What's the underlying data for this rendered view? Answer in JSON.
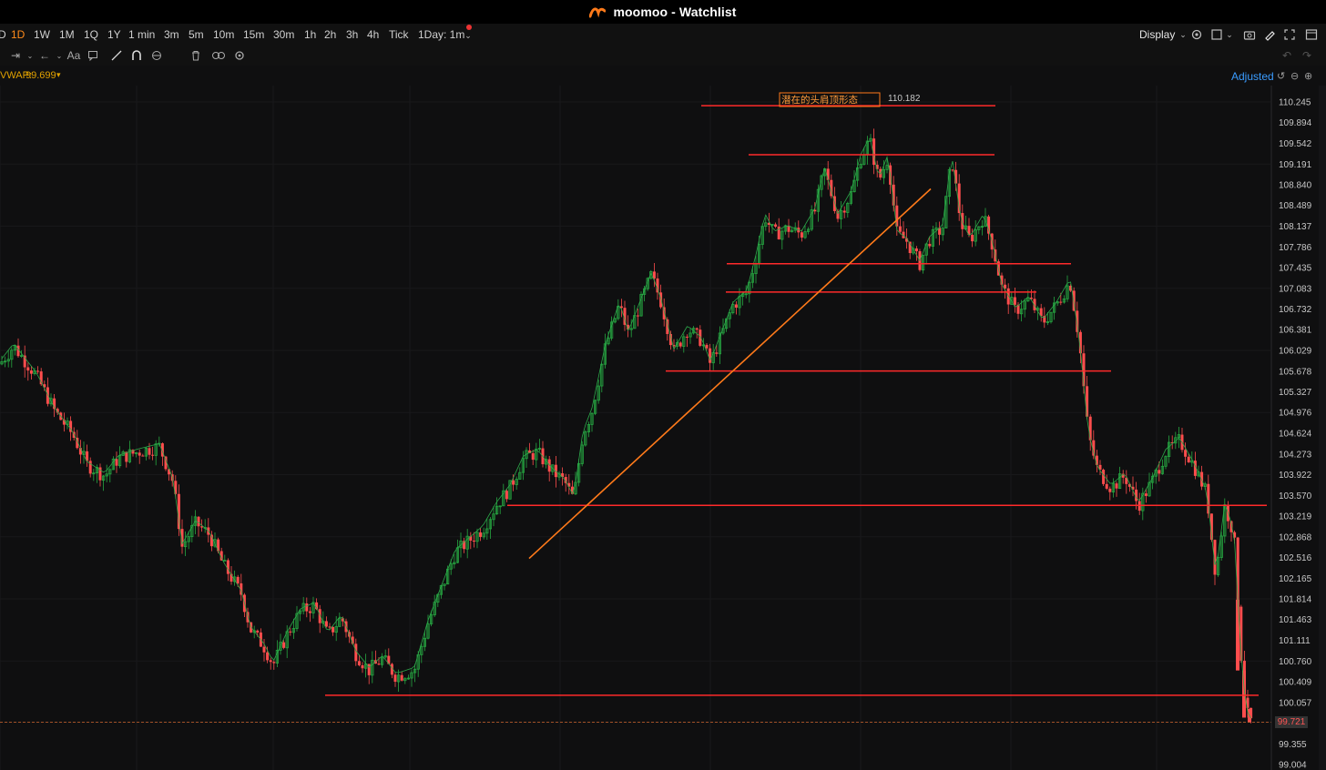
{
  "window": {
    "title": "moomoo - Watchlist"
  },
  "timeframes": [
    "D",
    "1D",
    "1W",
    "1M",
    "1Q",
    "1Y",
    "1 min",
    "3m",
    "5m",
    "10m",
    "15m",
    "30m",
    "1h",
    "2h",
    "3h",
    "4h",
    "Tick",
    "1Day: 1m"
  ],
  "active_timeframe": "1D",
  "display_label": "Display",
  "indicator": {
    "name": "VWAP:",
    "value": "99.699",
    "arrow": "▾",
    "color": "#e0a100"
  },
  "adjusted_label": "Adjusted",
  "annotation": {
    "text": "潜在的头肩顶形态",
    "high_value": "110.182"
  },
  "current_price": "99.721",
  "colors": {
    "up": "#26a641",
    "down": "#ff4d4d",
    "hline": "#ff2a2a",
    "trend": "#ff7a1a",
    "vwap": "#e0a100",
    "accent": "#ff8a1a"
  },
  "icons": [
    "logo-icon",
    "chevron-down-icon",
    "gear-icon",
    "square-icon",
    "camera-icon",
    "pen-icon",
    "expand-icon",
    "window-icon",
    "ruler-icon",
    "arrow-icon",
    "text-icon",
    "comment-icon",
    "line-tool-icon",
    "magnet-icon",
    "lock-icon",
    "trash-icon",
    "link-icon",
    "settings-icon",
    "undo-icon",
    "redo-icon",
    "reset-icon",
    "zoom-out-icon",
    "zoom-in-icon"
  ],
  "chart_data": {
    "type": "candlestick",
    "y_ticks": [
      "110.245",
      "109.894",
      "109.542",
      "109.191",
      "108.840",
      "108.489",
      "108.137",
      "107.786",
      "107.435",
      "107.083",
      "106.732",
      "106.381",
      "106.029",
      "105.678",
      "105.327",
      "104.976",
      "104.624",
      "104.273",
      "103.922",
      "103.570",
      "103.219",
      "102.868",
      "102.516",
      "102.165",
      "101.814",
      "101.463",
      "101.111",
      "100.760",
      "100.409",
      "100.057",
      "99.721",
      "99.355",
      "99.004"
    ],
    "ylim": [
      99.004,
      110.245
    ],
    "price_path": [
      [
        0,
        105.8
      ],
      [
        15,
        106.1
      ],
      [
        40,
        105.6
      ],
      [
        60,
        105.0
      ],
      [
        80,
        104.6
      ],
      [
        95,
        104.1
      ],
      [
        115,
        103.9
      ],
      [
        130,
        104.2
      ],
      [
        150,
        104.3
      ],
      [
        175,
        104.4
      ],
      [
        190,
        103.8
      ],
      [
        200,
        102.7
      ],
      [
        215,
        103.1
      ],
      [
        230,
        102.9
      ],
      [
        245,
        102.4
      ],
      [
        265,
        101.9
      ],
      [
        275,
        101.3
      ],
      [
        290,
        101.0
      ],
      [
        300,
        100.7
      ],
      [
        315,
        101.2
      ],
      [
        330,
        101.6
      ],
      [
        345,
        101.7
      ],
      [
        360,
        101.2
      ],
      [
        375,
        101.5
      ],
      [
        390,
        100.9
      ],
      [
        405,
        100.6
      ],
      [
        420,
        100.8
      ],
      [
        435,
        100.5
      ],
      [
        455,
        100.6
      ],
      [
        470,
        101.4
      ],
      [
        485,
        102.0
      ],
      [
        500,
        102.6
      ],
      [
        515,
        102.8
      ],
      [
        530,
        103.0
      ],
      [
        545,
        103.4
      ],
      [
        560,
        103.7
      ],
      [
        575,
        104.2
      ],
      [
        590,
        104.3
      ],
      [
        605,
        104.0
      ],
      [
        620,
        103.8
      ],
      [
        630,
        103.5
      ],
      [
        640,
        104.6
      ],
      [
        650,
        105.0
      ],
      [
        665,
        106.1
      ],
      [
        680,
        106.8
      ],
      [
        690,
        106.3
      ],
      [
        705,
        106.9
      ],
      [
        715,
        107.3
      ],
      [
        725,
        106.9
      ],
      [
        740,
        106.0
      ],
      [
        755,
        106.4
      ],
      [
        770,
        106.2
      ],
      [
        780,
        105.8
      ],
      [
        795,
        106.4
      ],
      [
        805,
        106.8
      ],
      [
        820,
        107.0
      ],
      [
        830,
        107.6
      ],
      [
        840,
        108.3
      ],
      [
        850,
        108.0
      ],
      [
        865,
        108.1
      ],
      [
        880,
        108.0
      ],
      [
        895,
        108.4
      ],
      [
        905,
        109.1
      ],
      [
        920,
        108.3
      ],
      [
        935,
        108.7
      ],
      [
        945,
        109.3
      ],
      [
        955,
        109.6
      ],
      [
        965,
        108.9
      ],
      [
        975,
        109.3
      ],
      [
        985,
        108.0
      ],
      [
        995,
        107.9
      ],
      [
        1010,
        107.5
      ],
      [
        1020,
        107.9
      ],
      [
        1035,
        108.1
      ],
      [
        1045,
        109.3
      ],
      [
        1055,
        108.2
      ],
      [
        1065,
        107.9
      ],
      [
        1080,
        108.3
      ],
      [
        1090,
        107.8
      ],
      [
        1100,
        107.1
      ],
      [
        1115,
        106.7
      ],
      [
        1130,
        106.9
      ],
      [
        1145,
        106.5
      ],
      [
        1160,
        106.8
      ],
      [
        1175,
        107.2
      ],
      [
        1185,
        106.2
      ],
      [
        1195,
        104.6
      ],
      [
        1205,
        104.0
      ],
      [
        1220,
        103.7
      ],
      [
        1235,
        103.9
      ],
      [
        1250,
        103.4
      ],
      [
        1265,
        103.8
      ],
      [
        1280,
        104.3
      ],
      [
        1295,
        104.5
      ],
      [
        1310,
        104.1
      ],
      [
        1325,
        103.6
      ],
      [
        1335,
        102.2
      ],
      [
        1345,
        103.4
      ],
      [
        1355,
        102.9
      ],
      [
        1362,
        101.0
      ],
      [
        1368,
        99.9
      ],
      [
        1375,
        99.7
      ]
    ],
    "horizontal_lines": [
      {
        "price": 110.182,
        "x1": 770,
        "x2": 1093
      },
      {
        "price": 109.35,
        "x1": 822,
        "x2": 1092
      },
      {
        "price": 107.5,
        "x1": 798,
        "x2": 1176
      },
      {
        "price": 107.02,
        "x1": 797,
        "x2": 1138
      },
      {
        "price": 105.68,
        "x1": 731,
        "x2": 1220
      },
      {
        "price": 103.4,
        "x1": 557,
        "x2": 1391
      },
      {
        "price": 100.18,
        "x1": 357,
        "x2": 1382
      }
    ],
    "trend_line": {
      "x1": 581,
      "p1": 102.5,
      "x2": 1022,
      "p2": 108.77
    },
    "current_price_line": 99.721
  }
}
